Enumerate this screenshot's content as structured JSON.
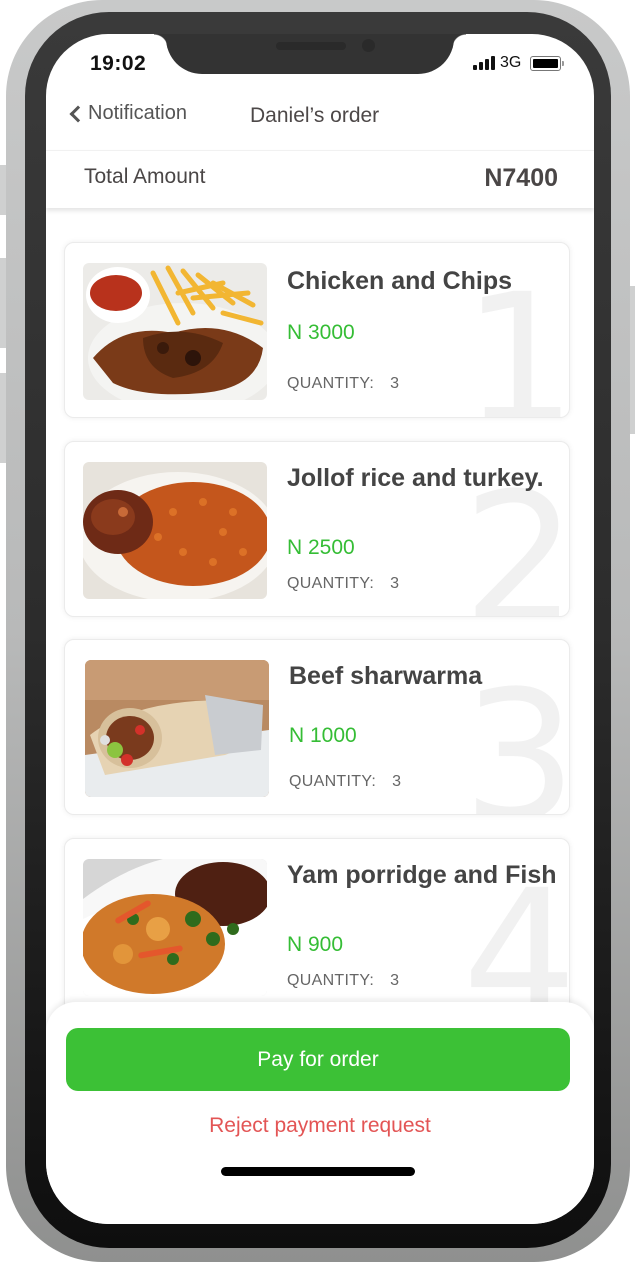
{
  "status_bar": {
    "time": "19:02",
    "network": "3G",
    "signal_icon": "cellular-signal-icon",
    "battery_icon": "battery-icon"
  },
  "nav": {
    "back_label": "Notification",
    "back_icon": "chevron-left-icon",
    "title": "Daniel’s order"
  },
  "summary": {
    "total_label": "Total Amount",
    "total_value": "N7400"
  },
  "items": [
    {
      "index": "1",
      "name": "Chicken and Chips",
      "price": "N 3000",
      "quantity_label": "QUANTITY:",
      "quantity": "3",
      "image": "chicken-and-chips-photo"
    },
    {
      "index": "2",
      "name": "Jollof rice and turkey.",
      "price": "N 2500",
      "quantity_label": "QUANTITY:",
      "quantity": "3",
      "image": "jollof-rice-turkey-photo"
    },
    {
      "index": "3",
      "name": "Beef sharwarma",
      "price": "N 1000",
      "quantity_label": "QUANTITY:",
      "quantity": "3",
      "image": "beef-shawarma-photo"
    },
    {
      "index": "4",
      "name": "Yam porridge and Fish",
      "price": "N 900",
      "quantity_label": "QUANTITY:",
      "quantity": "3",
      "image": "yam-porridge-fish-photo"
    }
  ],
  "actions": {
    "pay_label": "Pay for order",
    "reject_label": "Reject payment request"
  },
  "colors": {
    "accent_green": "#3cc136",
    "price_green": "#35bd35",
    "reject_red": "#e35555",
    "text_dark": "#444444"
  }
}
